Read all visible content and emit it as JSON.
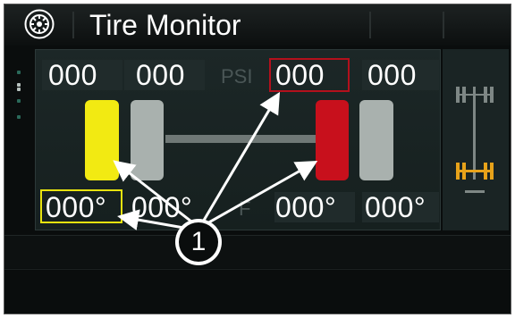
{
  "header": {
    "title": "Tire Monitor",
    "icon": "tire-icon"
  },
  "pressure": {
    "front_left": "000",
    "rear_left": "000",
    "unit": "PSI",
    "front_right": "000",
    "rear_right": "000"
  },
  "temperature": {
    "front_left": "000°",
    "rear_left": "000°",
    "unit": "F",
    "front_right": "000°",
    "rear_right": "000°"
  },
  "tires": {
    "front_left_status": "warning",
    "rear_left_status": "normal",
    "front_right_status": "alert",
    "rear_right_status": "normal"
  },
  "callout": {
    "label": "1"
  },
  "colors": {
    "warning": "#f2ea12",
    "alert": "#c8101c",
    "normal": "#a9b1ae",
    "axle_indicator": "#e7a21a"
  }
}
